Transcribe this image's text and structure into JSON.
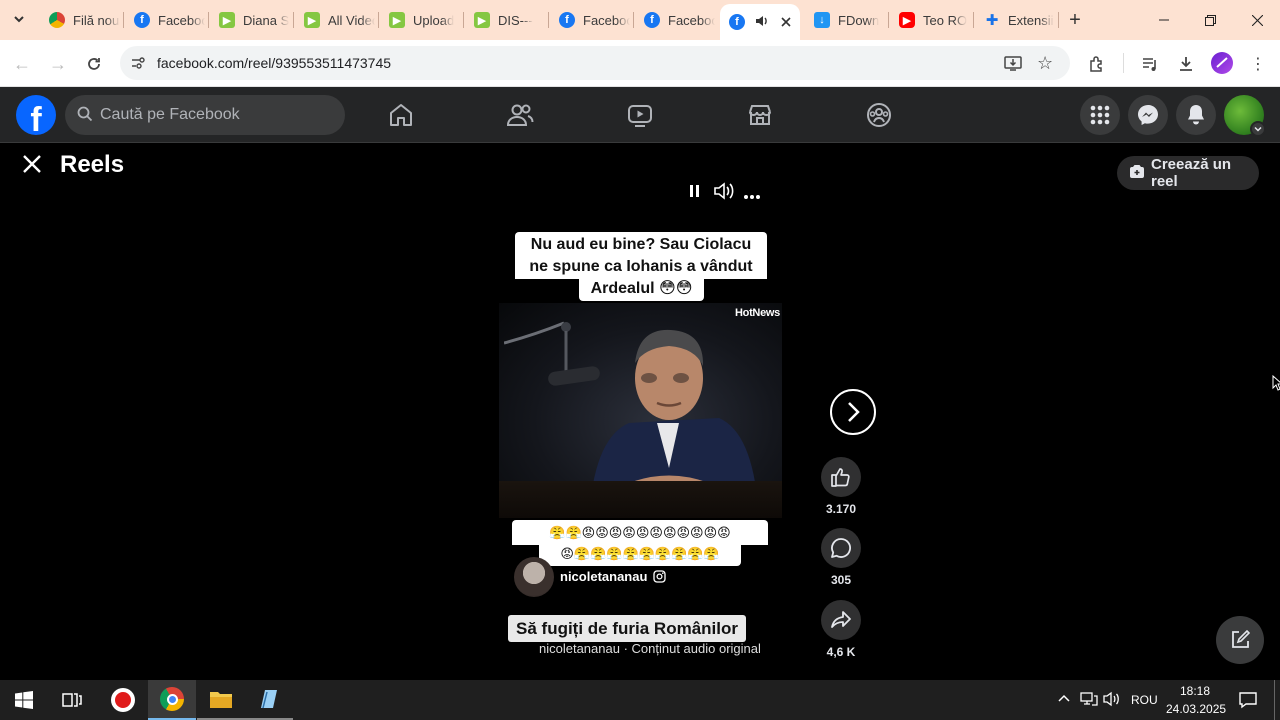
{
  "browser": {
    "tabs": [
      {
        "title": "Filă nouă",
        "icon": "chrome-icon"
      },
      {
        "title": "Facebook",
        "icon": "facebook-icon"
      },
      {
        "title": "Diana S",
        "icon": "rumble-icon"
      },
      {
        "title": "All Videos",
        "icon": "rumble-icon"
      },
      {
        "title": "Upload",
        "icon": "rumble-icon"
      },
      {
        "title": "DIS---",
        "icon": "rumble-icon"
      },
      {
        "title": "Facebook",
        "icon": "facebook-icon"
      },
      {
        "title": "Facebook",
        "icon": "facebook-icon"
      },
      {
        "title": "",
        "icon": "facebook-icon",
        "active": true
      },
      {
        "title": "FDown",
        "icon": "fdown-icon"
      },
      {
        "title": "Teo RO",
        "icon": "youtube-icon"
      },
      {
        "title": "Extensii",
        "icon": "puzzle-icon"
      }
    ],
    "url": "facebook.com/reel/939553511473745"
  },
  "facebook": {
    "search_placeholder": "Caută pe Facebook"
  },
  "reels": {
    "title": "Reels",
    "create_button": "Creează un reel",
    "video": {
      "top_caption_lines": [
        "Nu aud eu bine? Sau Ciolacu",
        "ne spune ca Iohanis a vândut",
        "Ardealul 😳😳"
      ],
      "watermark": "HotNews",
      "emoji_line_1": "😤😤😡😡😡😡😡😡😡😡😡😡😡",
      "emoji_line_2": "😡😤😤😤😤😤😤😤😤😤",
      "author": "nicoletananau",
      "bottom_caption": "Să fugiți de furia Românilor",
      "audio": "nicoletananau · Conținut audio original"
    },
    "likes": "3.170",
    "comments": "305",
    "shares": "4,6 K"
  },
  "taskbar": {
    "language": "ROU",
    "time": "18:18",
    "date": "24.03.2025"
  },
  "colors": {
    "fb_blue": "#0866ff",
    "tabstrip_bg": "#fde2d2",
    "fb_header_bg": "#242526"
  }
}
